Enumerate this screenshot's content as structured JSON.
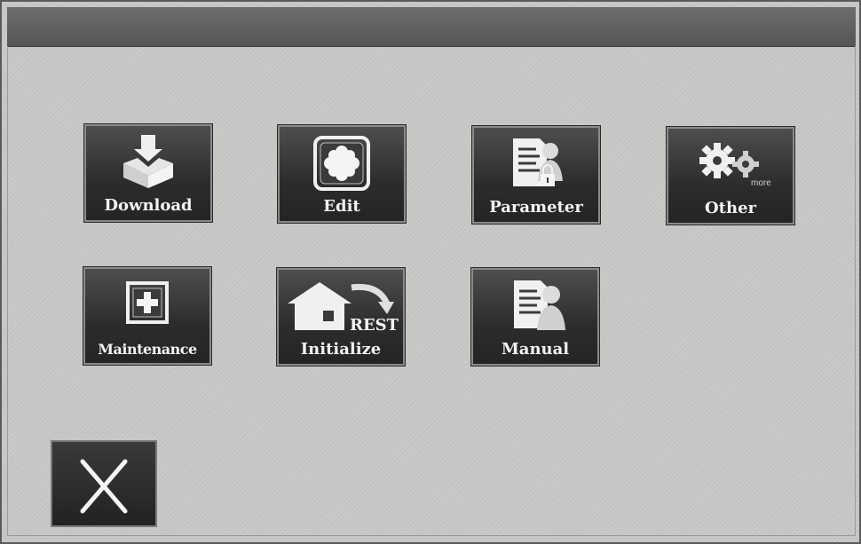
{
  "menu": {
    "items": [
      {
        "id": "download",
        "label": "Download",
        "icon": "download-tray-icon"
      },
      {
        "id": "edit",
        "label": "Edit",
        "icon": "edit-pattern-icon"
      },
      {
        "id": "parameter",
        "label": "Parameter",
        "icon": "parameter-document-lock-icon"
      },
      {
        "id": "other",
        "label": "Other",
        "icon": "gears-more-icon"
      },
      {
        "id": "maintenance",
        "label": "Maintenance",
        "icon": "plus-box-icon"
      },
      {
        "id": "initialize",
        "label": "Initialize",
        "icon": "house-reset-icon"
      },
      {
        "id": "manual",
        "label": "Manual",
        "icon": "manual-document-person-icon"
      }
    ]
  },
  "icons": {
    "initialize_badge": "REST",
    "other_badge": "more"
  },
  "close": {
    "icon": "close-x-icon"
  },
  "colors": {
    "background": "#c8c8c6",
    "title_bar": "#5f5f5f",
    "button": "#2c2c2c",
    "button_text": "#f2f2f2",
    "icon_fill": "#f0f0f0"
  }
}
